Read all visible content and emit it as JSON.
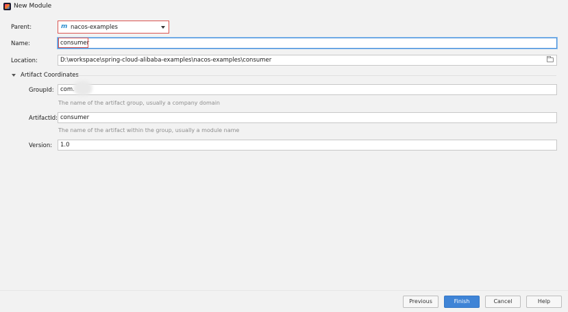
{
  "window": {
    "title": "New Module"
  },
  "form": {
    "parent": {
      "label": "Parent:",
      "value": "nacos-examples",
      "icon": "maven-m-icon"
    },
    "name": {
      "label": "Name:",
      "value": "consumer"
    },
    "location": {
      "label": "Location:",
      "value": "D:\\workspace\\spring-cloud-alibaba-examples\\nacos-examples\\consumer"
    }
  },
  "artifact": {
    "section_title": "Artifact Coordinates",
    "group_id": {
      "label": "GroupId:",
      "value": "com.",
      "hint": "The name of the artifact group, usually a company domain"
    },
    "artifact_id": {
      "label": "ArtifactId:",
      "value": "consumer",
      "hint": "The name of the artifact within the group, usually a module name"
    },
    "version": {
      "label": "Version:",
      "value": "1.0"
    }
  },
  "buttons": {
    "previous": "Previous",
    "finish": "Finish",
    "cancel": "Cancel",
    "help": "Help"
  },
  "colors": {
    "highlight": "#d9534f",
    "focus": "#4a90d9",
    "primary_button": "#3f84d6"
  }
}
